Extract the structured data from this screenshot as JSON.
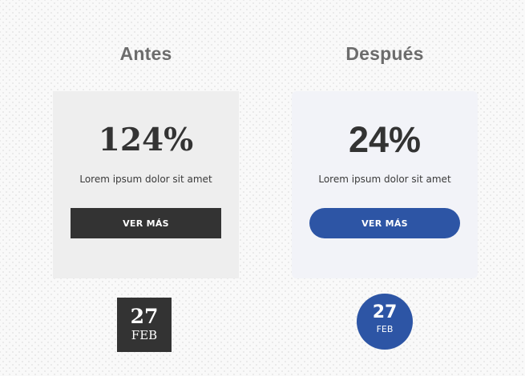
{
  "before": {
    "title": "Antes",
    "card": {
      "percent": "124%",
      "description": "Lorem ipsum dolor sit amet",
      "button_label": "VER MÁS"
    },
    "date": {
      "day": "27",
      "month": "FEB"
    }
  },
  "after": {
    "title": "Después",
    "card": {
      "percent": "24%",
      "description": "Lorem ipsum dolor sit amet",
      "button_label": "VER MÁS"
    },
    "date": {
      "day": "27",
      "month": "FEB"
    }
  },
  "colors": {
    "background": "#f9f9f9",
    "title_text": "#6c6c6c",
    "before_card": "#eeeeee",
    "after_card": "#f2f3f8",
    "before_accent": "#333333",
    "after_accent": "#2d55a5",
    "body_text": "#333333"
  }
}
